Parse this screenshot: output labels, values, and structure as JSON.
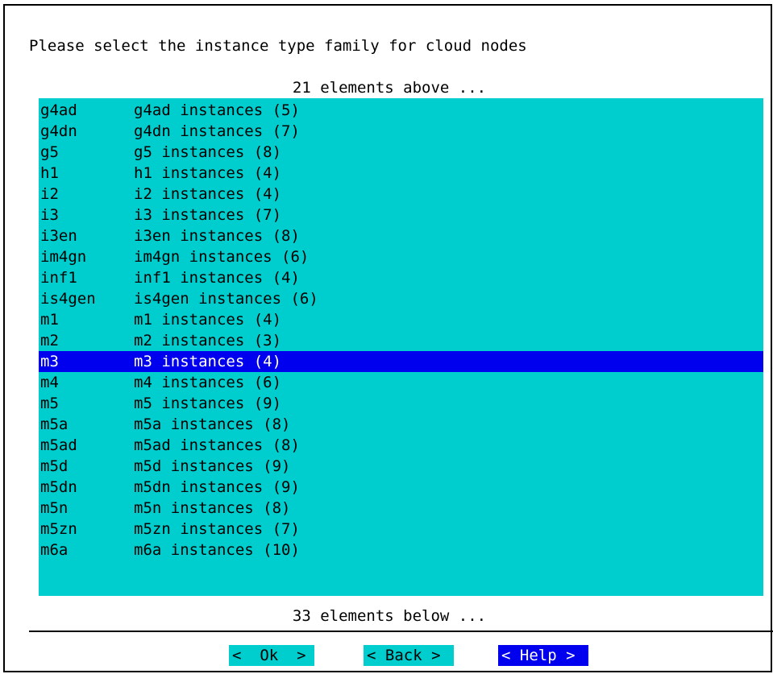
{
  "dialog": {
    "prompt": "Please select the instance type family for cloud nodes",
    "above_indicator": "21 elements above ...",
    "below_indicator": "33 elements below ...",
    "items": [
      {
        "key": "g4ad",
        "desc": "g4ad instances (5)"
      },
      {
        "key": "g4dn",
        "desc": "g4dn instances (7)"
      },
      {
        "key": "g5",
        "desc": "g5 instances (8)"
      },
      {
        "key": "h1",
        "desc": "h1 instances (4)"
      },
      {
        "key": "i2",
        "desc": "i2 instances (4)"
      },
      {
        "key": "i3",
        "desc": "i3 instances (7)"
      },
      {
        "key": "i3en",
        "desc": "i3en instances (8)"
      },
      {
        "key": "im4gn",
        "desc": "im4gn instances (6)"
      },
      {
        "key": "inf1",
        "desc": "inf1 instances (4)"
      },
      {
        "key": "is4gen",
        "desc": "is4gen instances (6)"
      },
      {
        "key": "m1",
        "desc": "m1 instances (4)"
      },
      {
        "key": "m2",
        "desc": "m2 instances (3)"
      },
      {
        "key": "m3",
        "desc": "m3 instances (4)"
      },
      {
        "key": "m4",
        "desc": "m4 instances (6)"
      },
      {
        "key": "m5",
        "desc": "m5 instances (9)"
      },
      {
        "key": "m5a",
        "desc": "m5a instances (8)"
      },
      {
        "key": "m5ad",
        "desc": "m5ad instances (8)"
      },
      {
        "key": "m5d",
        "desc": "m5d instances (9)"
      },
      {
        "key": "m5dn",
        "desc": "m5dn instances (9)"
      },
      {
        "key": "m5n",
        "desc": "m5n instances (8)"
      },
      {
        "key": "m5zn",
        "desc": "m5zn instances (7)"
      },
      {
        "key": "m6a",
        "desc": "m6a instances (10)"
      }
    ],
    "selected_key": "m3"
  },
  "buttons": {
    "ok": "<  Ok  >",
    "back": "< Back >",
    "help": "< Help >"
  },
  "colors": {
    "list_background": "#00cdcd",
    "selection_background": "#0000ee",
    "selection_text": "#ffffff"
  }
}
